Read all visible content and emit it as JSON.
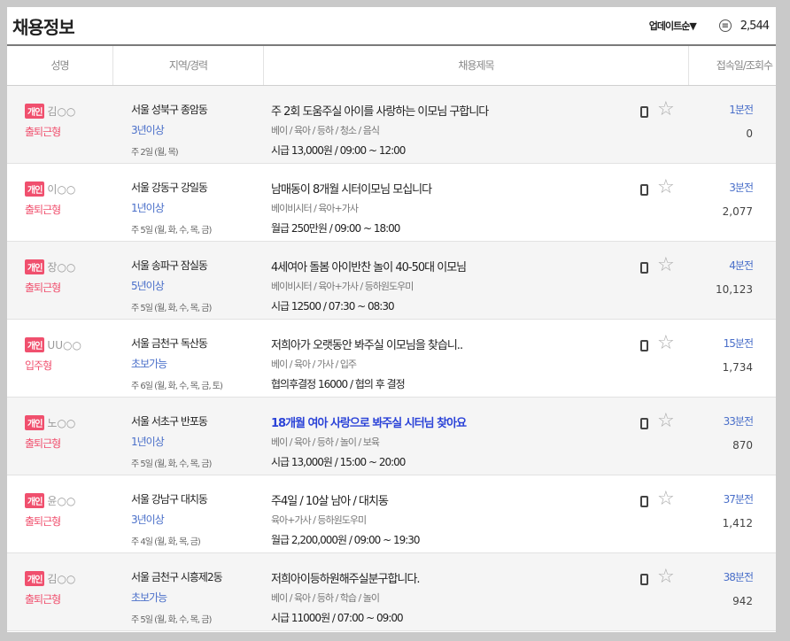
{
  "header": {
    "title": "채용정보",
    "sort_label": "업데이트순▼",
    "count": "2,544",
    "count_icon": "list-circle-icon"
  },
  "columns": [
    "성명",
    "지역/경력",
    "채용제목",
    "접속일/조회수"
  ],
  "colors": {
    "badge": "#f0506e",
    "blue": "#4a6fc9",
    "highlight": "#2b43d8"
  },
  "rows": [
    {
      "badge": "개인",
      "name": "김○○",
      "type": "출퇴근형",
      "location": "서울 성북구 종암동",
      "experience": "3년이상",
      "days": "주 2일 (월, 목)",
      "title": "주 2회 도움주실 아이를 사랑하는 이모님 구합니다",
      "categories": "베이 / 육아 / 등하 / 청소 / 음식",
      "pay": "시급 13,000원 / 09:00 ~ 12:00",
      "ago": "1분전",
      "views": "0"
    },
    {
      "badge": "개인",
      "name": "이○○",
      "type": "출퇴근형",
      "location": "서울 강동구 강일동",
      "experience": "1년이상",
      "days": "주 5일 (월, 화, 수, 목, 금)",
      "title": "남매동이 8개월 시터이모님 모십니다",
      "categories": "베이비시터 / 육아+가사",
      "pay": "월급 250만원 / 09:00 ~ 18:00",
      "ago": "3분전",
      "views": "2,077"
    },
    {
      "badge": "개인",
      "name": "장○○",
      "type": "출퇴근형",
      "location": "서울 송파구 잠실동",
      "experience": "5년이상",
      "days": "주 5일 (월, 화, 수, 목, 금)",
      "title": "4세여아 돌봄 아이반찬 놀이 40-50대 이모님",
      "categories": "베이비시터 / 육아+가사 / 등하원도우미",
      "pay": "시급 12500 / 07:30 ~ 08:30",
      "ago": "4분전",
      "views": "10,123"
    },
    {
      "badge": "개인",
      "name": "UU○○",
      "type": "입주형",
      "location": "서울 금천구 독산동",
      "experience": "초보가능",
      "days": "주 6일 (월, 화, 수, 목, 금, 토)",
      "title": "저희아가 오랫동안 봐주실 이모님을 찾습니..",
      "categories": "베이 / 육아 / 가사 / 입주",
      "pay": "협의후결정 16000 / 협의 후 결정",
      "ago": "15분전",
      "views": "1,734"
    },
    {
      "badge": "개인",
      "name": "노○○",
      "type": "출퇴근형",
      "location": "서울 서초구 반포동",
      "experience": "1년이상",
      "days": "주 5일 (월, 화, 수, 목, 금)",
      "title": "18개월 여아 사랑으로 봐주실 시터님 찾아요",
      "highlight": true,
      "categories": "베이 / 육아 / 등하 / 놀이 / 보육",
      "pay": "시급 13,000원 / 15:00 ~ 20:00",
      "ago": "33분전",
      "views": "870"
    },
    {
      "badge": "개인",
      "name": "윤○○",
      "type": "출퇴근형",
      "location": "서울 강남구 대치동",
      "experience": "3년이상",
      "days": "주 4일 (월, 화, 목, 금)",
      "title": "주4일 / 10살 남아 / 대치동",
      "categories": "육아+가사 / 등하원도우미",
      "pay": "월급 2,200,000원 / 09:00 ~ 19:30",
      "ago": "37분전",
      "views": "1,412"
    },
    {
      "badge": "개인",
      "name": "김○○",
      "type": "출퇴근형",
      "location": "서울 금천구 시흥제2동",
      "experience": "초보가능",
      "days": "주 5일 (월, 화, 수, 목, 금)",
      "title": "저희아이등하원해주실분구합니다.",
      "categories": "베이 / 육아 / 등하 / 학습 / 놀이",
      "pay": "시급 11000원 / 07:00 ~ 09:00",
      "ago": "38분전",
      "views": "942"
    }
  ]
}
